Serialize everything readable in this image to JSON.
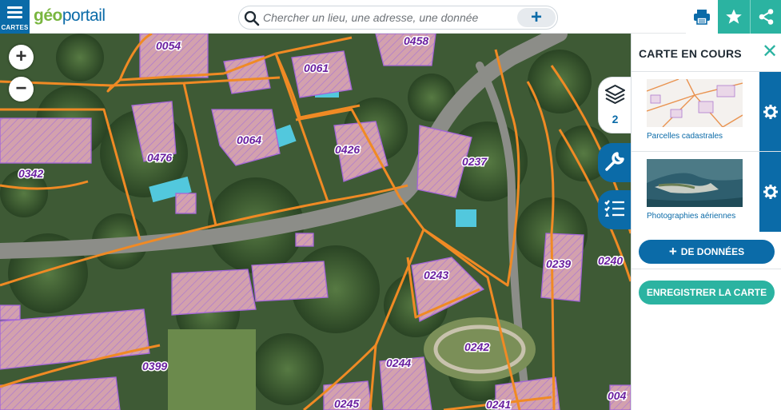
{
  "app": {
    "menu_label": "CARTES",
    "logo_part1": "géo",
    "logo_part2": "portail"
  },
  "search": {
    "placeholder": "Chercher un lieu, une adresse, une donnée",
    "value": "",
    "add_symbol": "+"
  },
  "toolbar": {
    "print_icon": "printer-icon",
    "favorite_icon": "star-icon",
    "share_icon": "share-icon",
    "accent_color": "#2bb3a1",
    "brand_color": "#0b6ba8"
  },
  "map": {
    "zoom_in": "+",
    "zoom_out": "−",
    "parcel_line_color": "#f08a24",
    "building_outline_color": "#a466d8",
    "parcel_labels": [
      "0054",
      "0458",
      "0061",
      "0476",
      "0064",
      "0426",
      "0237",
      "0342",
      "0239",
      "0240",
      "0243",
      "0242",
      "0399",
      "0244",
      "0245",
      "0241",
      "004"
    ]
  },
  "side_tabs": {
    "layers_count": "2",
    "layers_icon": "layers-icon",
    "tools_icon": "wrench-icon",
    "legend_icon": "list-icon"
  },
  "panel": {
    "title": "CARTE EN COURS",
    "layers": [
      {
        "name": "Parcelles cadastrales",
        "icon": "gear-icon"
      },
      {
        "name": "Photographies aériennes",
        "icon": "gear-icon"
      }
    ],
    "add_data_label": "DE DONNÉES",
    "add_data_symbol": "+",
    "save_label": "ENREGISTRER LA CARTE"
  }
}
